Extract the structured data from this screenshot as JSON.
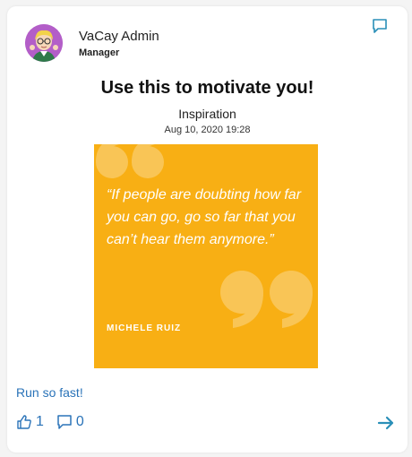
{
  "post": {
    "author_name": "VaCay Admin",
    "author_role": "Manager",
    "title": "Use this to motivate you!",
    "category": "Inspiration",
    "timestamp": "Aug 10, 2020 19:28",
    "body": "Run so fast!"
  },
  "image": {
    "quote": "“If people are doubting how far you can go, go so far that you can’t hear them anymore.”",
    "author": "MICHELE RUIZ",
    "background_color": "#f8af14"
  },
  "footer": {
    "like_count": "1",
    "comment_count": "0"
  },
  "icons": {
    "top_right": "comment-icon",
    "like": "thumbs-up-icon",
    "comment": "comment-icon",
    "open": "arrow-right-icon"
  },
  "colors": {
    "accent": "#2a73b8",
    "teal": "#2a8fb8"
  }
}
